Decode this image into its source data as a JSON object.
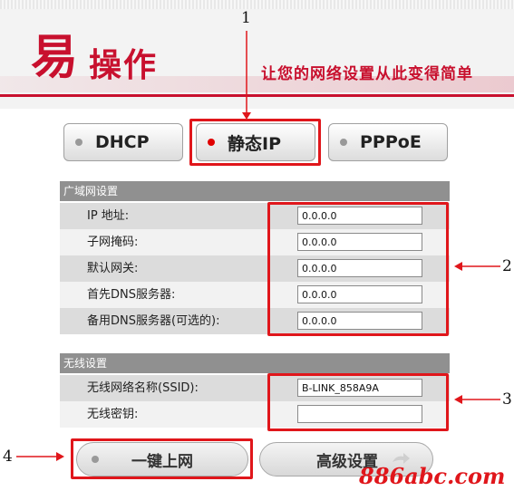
{
  "header": {
    "logo_big": "易",
    "logo_rest": "操作",
    "slogan": "让您的网络设置从此变得简单"
  },
  "mode_tabs": [
    {
      "label": "DHCP",
      "active": false
    },
    {
      "label": "静态IP",
      "active": true
    },
    {
      "label": "PPPoE",
      "active": false
    }
  ],
  "wan": {
    "title": "广域网设置",
    "fields": [
      {
        "label": "IP 地址:",
        "value": "0.0.0.0"
      },
      {
        "label": "子网掩码:",
        "value": "0.0.0.0"
      },
      {
        "label": "默认网关:",
        "value": "0.0.0.0"
      },
      {
        "label": "首先DNS服务器:",
        "value": "0.0.0.0"
      },
      {
        "label": "备用DNS服务器(可选的):",
        "value": "0.0.0.0"
      }
    ]
  },
  "wireless": {
    "title": "无线设置",
    "fields": [
      {
        "label": "无线网络名称(SSID):",
        "value": "B-LINK_858A9A"
      },
      {
        "label": "无线密钥:",
        "value": ""
      }
    ]
  },
  "buttons": {
    "one_click": "一键上网",
    "advanced": "高级设置"
  },
  "annotations": {
    "n1": "1",
    "n2": "2",
    "n3": "3",
    "n4": "4"
  },
  "watermark": "886abc.com",
  "colors": {
    "accent": "#c8102e",
    "annotation": "#e0161b",
    "section_bar": "#909090"
  }
}
